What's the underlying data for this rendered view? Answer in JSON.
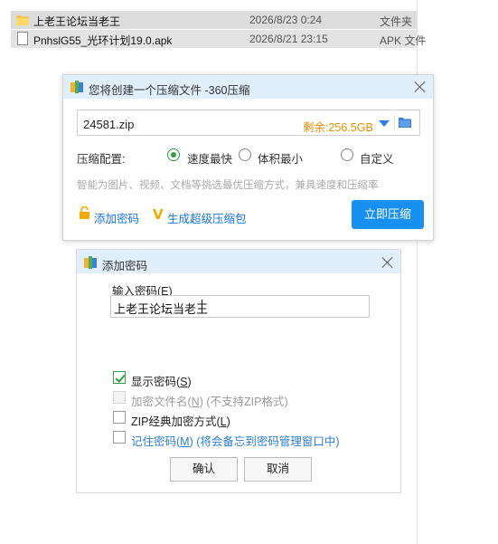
{
  "files": [
    {
      "name": "上老王论坛当老王",
      "date": "2026/8/23 0:24",
      "type": "文件夹",
      "icon": "folder-icon"
    },
    {
      "name": "PnhslG55_光环计划19.0.apk",
      "date": "2026/8/21 23:15",
      "type": "APK 文件",
      "icon": "apk-file-icon"
    }
  ],
  "compress_dialog": {
    "title": "您将创建一个压缩文件 -360压缩",
    "filename": "24581.zip",
    "free_space": "剩余:256.5GB",
    "config_label": "压缩配置:",
    "options": [
      "速度最快",
      "体积最小",
      "自定义"
    ],
    "selected_option": "速度最快",
    "hint": "智能为图片、视频、文档等挑选最优压缩方式，兼具速度和压缩率",
    "add_password": "添加密码",
    "super_package": "生成超级压缩包",
    "compress_button": "立即压缩",
    "accent_color": "#1890f0"
  },
  "password_dialog": {
    "title": "添加密码",
    "input_label": "输入密码(",
    "input_label_key": "E",
    "input_label_end": ")",
    "password_value": "上老王论坛当老王",
    "show_password": {
      "text": "显示密码(",
      "key": "S",
      "end": ")",
      "checked": true
    },
    "encrypt_names": {
      "text": "加密文件名(",
      "key": "N",
      "end": ") (不支持ZIP格式)",
      "checked": false,
      "disabled": true
    },
    "zip_classic": {
      "text": "ZIP经典加密方式(",
      "key": "L",
      "end": ")",
      "checked": false
    },
    "remember": {
      "text": "记住密码(",
      "key": "M",
      "end": ") (将会备忘到密码管理窗口中)",
      "checked": false
    },
    "ok": "确认",
    "cancel": "取消"
  }
}
